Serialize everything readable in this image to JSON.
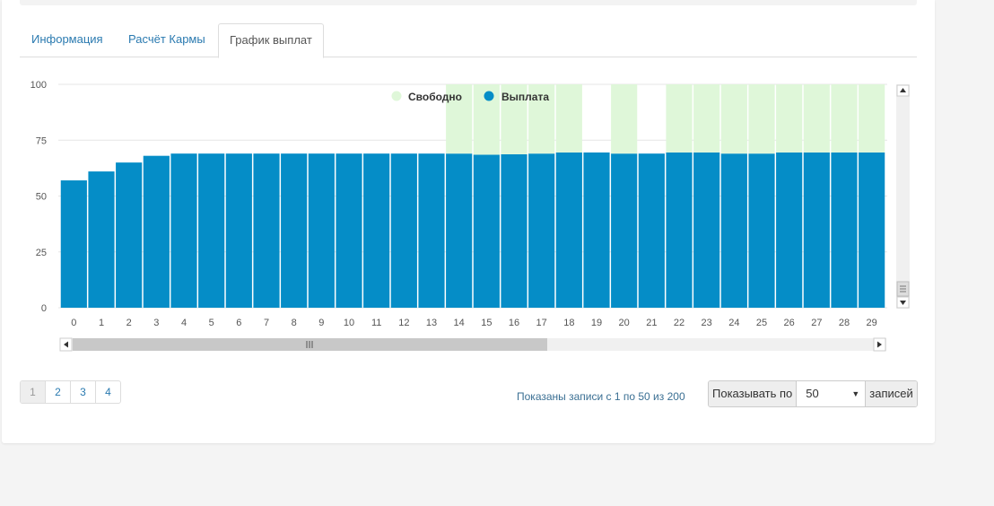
{
  "tabs": [
    {
      "label": "Информация"
    },
    {
      "label": "Расчёт Кармы"
    },
    {
      "label": "График выплат"
    }
  ],
  "legend": {
    "free": "Свободно",
    "payment": "Выплата"
  },
  "colors": {
    "payment": "#058dc7",
    "free": "#dff7d9",
    "link": "#2a7ab0"
  },
  "chart_data": {
    "type": "bar",
    "stacked": true,
    "legend_position": "top-center",
    "grid": true,
    "ylim": [
      0,
      100
    ],
    "yticks": [
      0,
      25,
      50,
      75,
      100
    ],
    "categories": [
      "0",
      "1",
      "2",
      "3",
      "4",
      "5",
      "6",
      "7",
      "8",
      "9",
      "10",
      "11",
      "12",
      "13",
      "14",
      "15",
      "16",
      "17",
      "18",
      "19",
      "20",
      "21",
      "22",
      "23",
      "24",
      "25",
      "26",
      "27",
      "28",
      "29"
    ],
    "series": [
      {
        "name": "Выплата",
        "color": "#058dc7",
        "values": [
          57,
          61,
          65,
          68,
          69,
          69,
          69,
          69,
          69,
          69,
          69,
          69,
          69,
          69,
          69,
          68.5,
          68.7,
          69,
          69.5,
          69.5,
          69,
          69,
          69.5,
          69.5,
          69,
          69,
          69.5,
          69.5,
          69.5,
          69.5
        ]
      },
      {
        "name": "Свободно",
        "color": "#dff7d9",
        "values": [
          0,
          0,
          0,
          0,
          0,
          0,
          0,
          0,
          0,
          0,
          0,
          0,
          0,
          0,
          31,
          31.5,
          31.3,
          31,
          30.5,
          0,
          31,
          0,
          30.5,
          30.5,
          31,
          31,
          30.5,
          30.5,
          30.5,
          30.5
        ]
      }
    ]
  },
  "pagination": {
    "pages": [
      "1",
      "2",
      "3",
      "4"
    ]
  },
  "records_info": "Показаны записи с 1 по 50 из 200",
  "length_menu": {
    "prefix": "Показывать по",
    "value": "50",
    "suffix": "записей"
  }
}
